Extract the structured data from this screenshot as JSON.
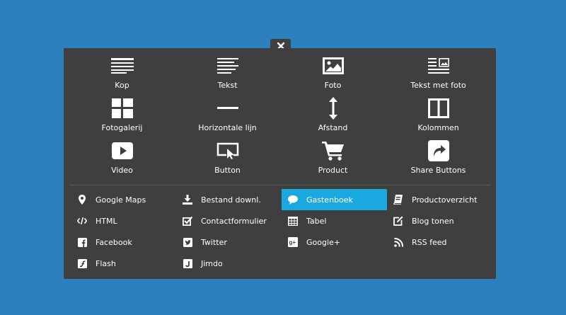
{
  "close_label": "×",
  "colors": {
    "background": "#2c80bb",
    "panel": "#3f3f3f",
    "active": "#1aa8e1"
  },
  "tiles": [
    {
      "label": "Kop",
      "icon": "heading-icon"
    },
    {
      "label": "Tekst",
      "icon": "text-icon"
    },
    {
      "label": "Foto",
      "icon": "photo-icon"
    },
    {
      "label": "Tekst met foto",
      "icon": "text-with-photo-icon"
    },
    {
      "label": "Fotogalerij",
      "icon": "gallery-icon"
    },
    {
      "label": "Horizontale lijn",
      "icon": "horizontal-line-icon"
    },
    {
      "label": "Afstand",
      "icon": "spacing-icon"
    },
    {
      "label": "Kolommen",
      "icon": "columns-icon"
    },
    {
      "label": "Video",
      "icon": "video-icon"
    },
    {
      "label": "Button",
      "icon": "button-icon"
    },
    {
      "label": "Product",
      "icon": "cart-icon"
    },
    {
      "label": "Share Buttons",
      "icon": "share-icon"
    }
  ],
  "list": [
    {
      "label": "Google Maps",
      "icon": "map-pin-icon"
    },
    {
      "label": "Bestand downl.",
      "icon": "download-icon"
    },
    {
      "label": "Gastenboek",
      "icon": "speech-bubble-icon",
      "active": true
    },
    {
      "label": "Productoverzicht",
      "icon": "product-overview-icon"
    },
    {
      "label": "HTML",
      "icon": "code-icon"
    },
    {
      "label": "Contactformulier",
      "icon": "checkbox-icon"
    },
    {
      "label": "Tabel",
      "icon": "table-icon"
    },
    {
      "label": "Blog tonen",
      "icon": "edit-icon"
    },
    {
      "label": "Facebook",
      "icon": "facebook-icon"
    },
    {
      "label": "Twitter",
      "icon": "twitter-icon"
    },
    {
      "label": "Google+",
      "icon": "google-plus-icon"
    },
    {
      "label": "RSS feed",
      "icon": "rss-icon"
    },
    {
      "label": "Flash",
      "icon": "flash-icon"
    },
    {
      "label": "Jimdo",
      "icon": "jimdo-icon"
    }
  ]
}
